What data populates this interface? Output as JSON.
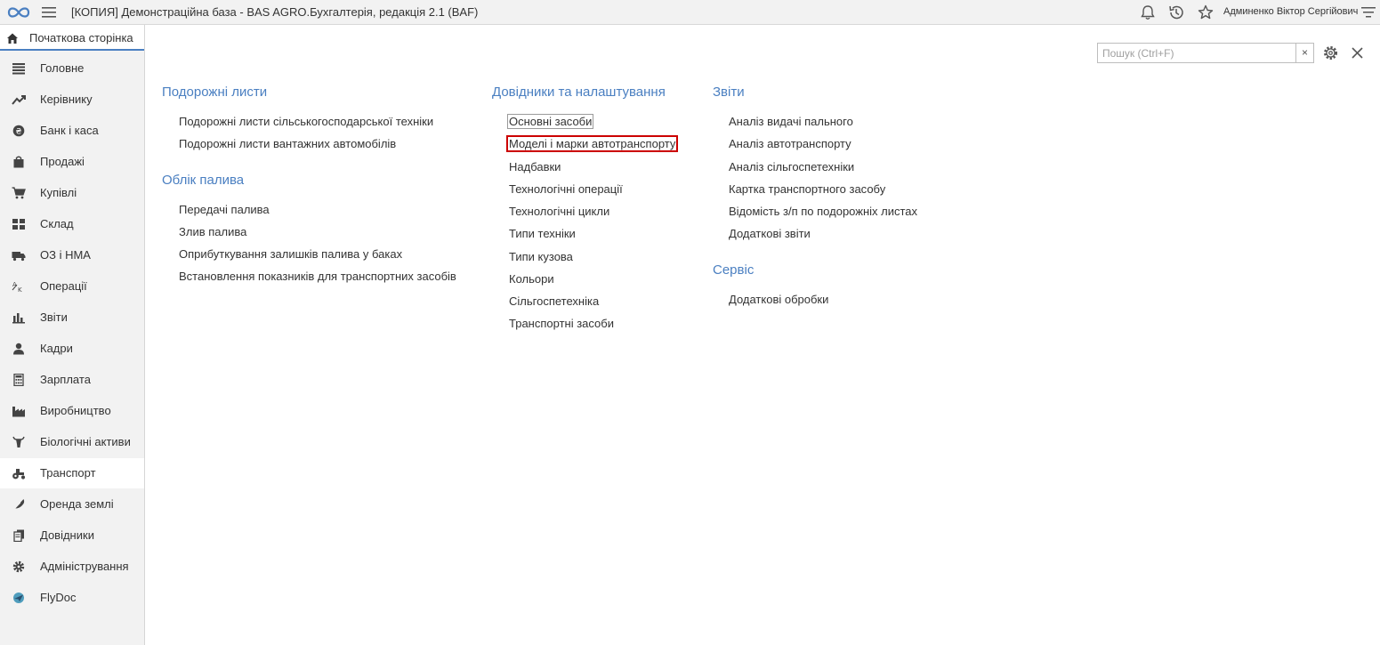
{
  "app": {
    "title": "[КОПИЯ] Демонстраційна база - BAS AGRO.Бухгалтерія, редакція 2.1  (BAF)",
    "user": "Админенко Віктор Сергійович"
  },
  "home_tab": {
    "label": "Початкова сторінка"
  },
  "sidebar": {
    "items": [
      {
        "label": "Головне"
      },
      {
        "label": "Керівнику"
      },
      {
        "label": "Банк і каса"
      },
      {
        "label": "Продажі"
      },
      {
        "label": "Купівлі"
      },
      {
        "label": "Склад"
      },
      {
        "label": "ОЗ і НМА"
      },
      {
        "label": "Операції"
      },
      {
        "label": "Звіти"
      },
      {
        "label": "Кадри"
      },
      {
        "label": "Зарплата"
      },
      {
        "label": "Виробництво"
      },
      {
        "label": "Біологічні активи"
      },
      {
        "label": "Транспорт"
      },
      {
        "label": "Оренда землі"
      },
      {
        "label": "Довідники"
      },
      {
        "label": "Адміністрування"
      },
      {
        "label": "FlyDoc"
      }
    ],
    "active": "Транспорт"
  },
  "search": {
    "placeholder": "Пошук (Ctrl+F)",
    "value": "",
    "clear_label": "×"
  },
  "sections": {
    "waybills": {
      "title": "Подорожні листи",
      "links": [
        "Подорожні листи сільськогосподарської техніки",
        "Подорожні листи вантажних автомобілів"
      ]
    },
    "fuel": {
      "title": "Облік палива",
      "links": [
        "Передачі палива",
        "Злив палива",
        "Оприбуткування залишків палива у баках",
        "Встановлення показників для транспортних засобів"
      ]
    },
    "references": {
      "title": "Довідники та налаштування",
      "links": [
        "Основні засоби",
        "Моделі і марки автотранспорту",
        "Надбавки",
        "Технологічні операції",
        "Технологічні цикли",
        "Типи техніки",
        "Типи кузова",
        "Кольори",
        "Сільгоспетехніка",
        "Транспортні засоби"
      ]
    },
    "reports": {
      "title": "Звіти",
      "links": [
        "Аналіз видачі пального",
        "Аналіз автотранспорту",
        "Аналіз сільгоспетехніки",
        "Картка транспортного засобу",
        "Відомість з/п по подорожніх листах",
        "Додаткові звіти"
      ]
    },
    "service": {
      "title": "Сервіс",
      "links": [
        "Додаткові обробки"
      ]
    }
  },
  "colors": {
    "accent": "#4a7fc1",
    "highlight": "#cc0000",
    "sidebar_bg": "#f2f2f2"
  }
}
